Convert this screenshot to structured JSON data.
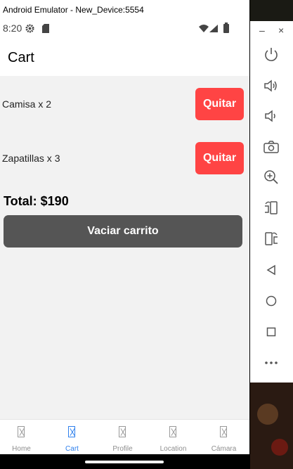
{
  "emulator": {
    "window_title": "Android Emulator - New_Device:5554",
    "toolbar_icons": [
      "power-icon",
      "volume-up-icon",
      "volume-down-icon",
      "camera-icon",
      "zoom-icon",
      "rotate-left-icon",
      "rotate-right-icon",
      "back-icon",
      "home-icon",
      "overview-icon",
      "more-icon"
    ],
    "window_min": "–",
    "window_close": "×"
  },
  "status_bar": {
    "time": "8:20"
  },
  "header": {
    "title": "Cart"
  },
  "cart": {
    "items": [
      {
        "label": "Camisa x 2",
        "button": "Quitar"
      },
      {
        "label": "Zapatillas x 3",
        "button": "Quitar"
      }
    ],
    "total": "Total: $190",
    "clear_button": "Vaciar carrito"
  },
  "tabs": [
    {
      "label": "Home",
      "active": false
    },
    {
      "label": "Cart",
      "active": true
    },
    {
      "label": "Profile",
      "active": false
    },
    {
      "label": "Location",
      "active": false
    },
    {
      "label": "Cámara",
      "active": false
    }
  ],
  "colors": {
    "remove_button": "#ff4444",
    "clear_button": "#555555",
    "active_tab": "#2f80ed",
    "inactive_tab": "#8e8e8e",
    "content_bg": "#f2f2f2"
  }
}
